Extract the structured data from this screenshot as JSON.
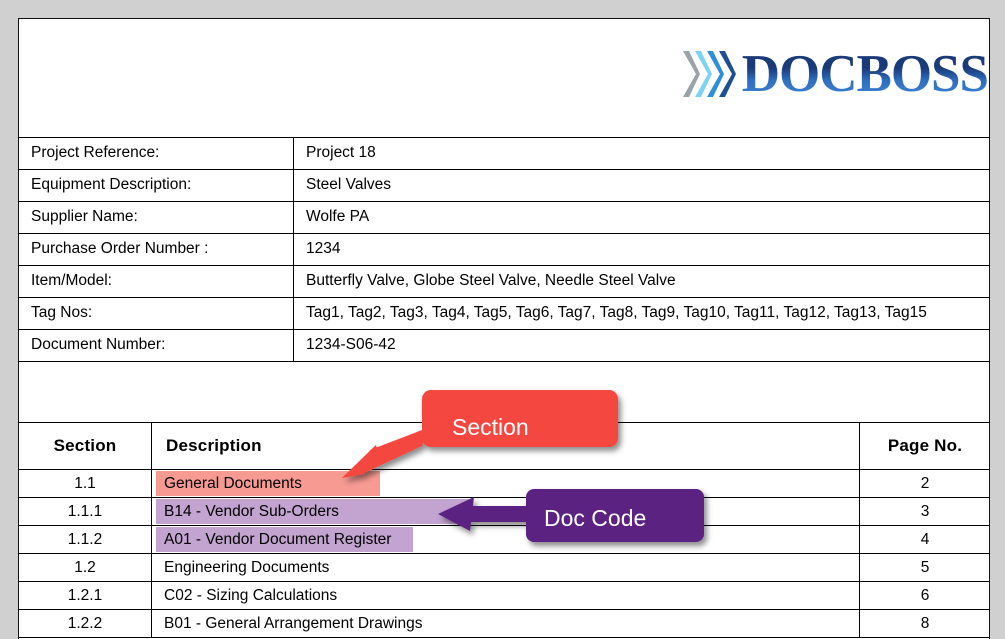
{
  "logo": {
    "word": "DOCBOSS",
    "chevron_colors": [
      "#9aa3a8",
      "#7fd3f2",
      "#2f8fd6",
      "#1f4f93"
    ],
    "text_color_dark": "#1b3a7a",
    "text_color_light": "#3f86d8"
  },
  "info_table": {
    "rows": [
      {
        "label": "Project Reference:",
        "value": "Project 18"
      },
      {
        "label": "Equipment Description:",
        "value": "Steel Valves"
      },
      {
        "label": "Supplier Name:",
        "value": "Wolfe PA"
      },
      {
        "label": "Purchase Order Number :",
        "value": "1234"
      },
      {
        "label": "Item/Model:",
        "value": "Butterfly Valve, Globe Steel Valve, Needle Steel Valve"
      },
      {
        "label": "Tag Nos:",
        "value": "Tag1, Tag2, Tag3, Tag4, Tag5, Tag6, Tag7, Tag8, Tag9, Tag10, Tag11, Tag12, Tag13, Tag15"
      },
      {
        "label": "Document Number:",
        "value": "1234-S06-42"
      }
    ]
  },
  "section_table": {
    "headers": {
      "section": "Section",
      "description": "Description",
      "page_no": "Page No."
    },
    "rows": [
      {
        "section": "1.1",
        "description": "General Documents",
        "page": "2"
      },
      {
        "section": "1.1.1",
        "description": "B14 - Vendor Sub-Orders",
        "page": "3"
      },
      {
        "section": "1.1.2",
        "description": "A01 - Vendor Document Register",
        "page": "4"
      },
      {
        "section": "1.2",
        "description": "Engineering Documents",
        "page": "5"
      },
      {
        "section": "1.2.1",
        "description": "C02 - Sizing Calculations",
        "page": "6"
      },
      {
        "section": "1.2.2",
        "description": "B01 - General Arrangement Drawings",
        "page": "8"
      }
    ]
  },
  "callouts": {
    "section": {
      "label": "Section",
      "color": "#f4473f",
      "text_color": "#ffffff"
    },
    "doc_code": {
      "label": "Doc Code",
      "color": "#5b2282",
      "text_color": "#ffffff"
    }
  },
  "highlights": {
    "pink": "#f79a92",
    "purple": "#c3a3cf"
  }
}
